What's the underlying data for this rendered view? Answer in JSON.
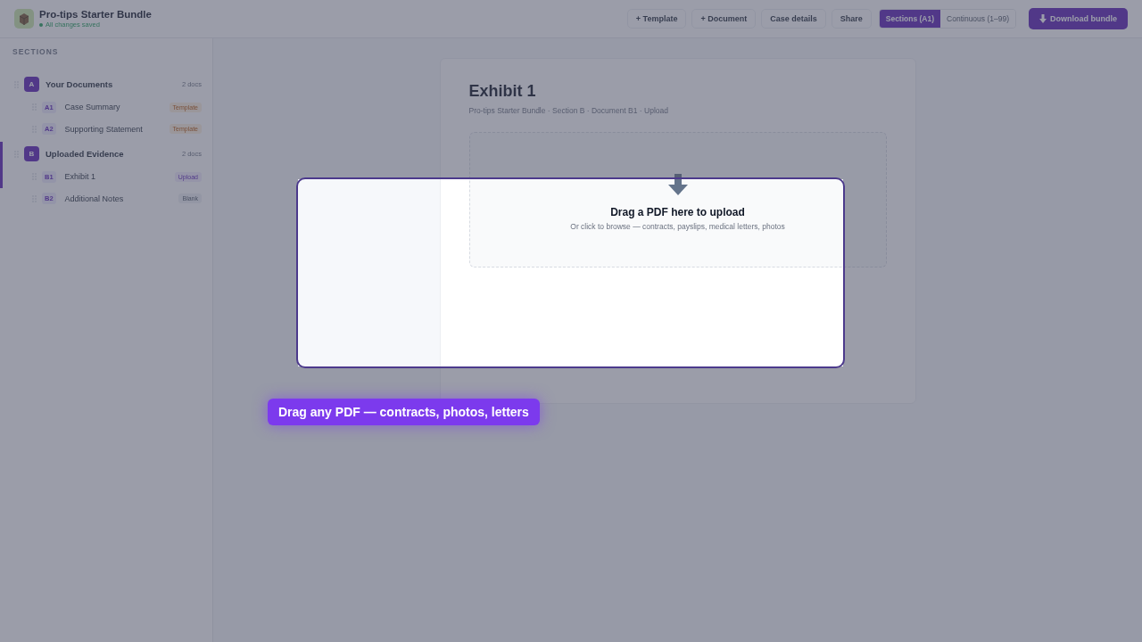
{
  "header": {
    "title": "Pro-tips Starter Bundle",
    "status": "All changes saved"
  },
  "toolbar": {
    "buttons": [
      "+ Template",
      "+ Document",
      "Case details",
      "Share"
    ],
    "view_modes": [
      {
        "label": "Sections (A1)",
        "selected": true
      },
      {
        "label": "Continuous (1–99)",
        "selected": false
      }
    ],
    "primary": "Download bundle"
  },
  "sidebar": {
    "heading": "SECTIONS",
    "sections": [
      {
        "badge": "A",
        "title": "Your Documents",
        "count": "2 docs",
        "selected": false,
        "children": [
          {
            "code": "A1",
            "name": "Case Summary",
            "tag": "Template",
            "kind": "template",
            "selected": false
          },
          {
            "code": "A2",
            "name": "Supporting Statement",
            "tag": "Template",
            "kind": "template",
            "selected": false
          }
        ]
      },
      {
        "badge": "B",
        "title": "Uploaded Evidence",
        "count": "2 docs",
        "selected": true,
        "children": [
          {
            "code": "B1",
            "name": "Exhibit 1",
            "tag": "Upload",
            "kind": "upload",
            "selected": true
          },
          {
            "code": "B2",
            "name": "Additional Notes",
            "tag": "Blank",
            "kind": "blank",
            "selected": false
          }
        ]
      }
    ]
  },
  "document": {
    "title": "Exhibit 1",
    "breadcrumb": "Pro-tips Starter Bundle · Section B · Document B1 · Upload",
    "dropzone": {
      "heading": "Drag a PDF here to upload",
      "hint": "Or click to browse — contracts, payslips, medical letters, photos"
    }
  },
  "tour": {
    "tooltip": "Drag any PDF — contracts, photos, letters"
  }
}
